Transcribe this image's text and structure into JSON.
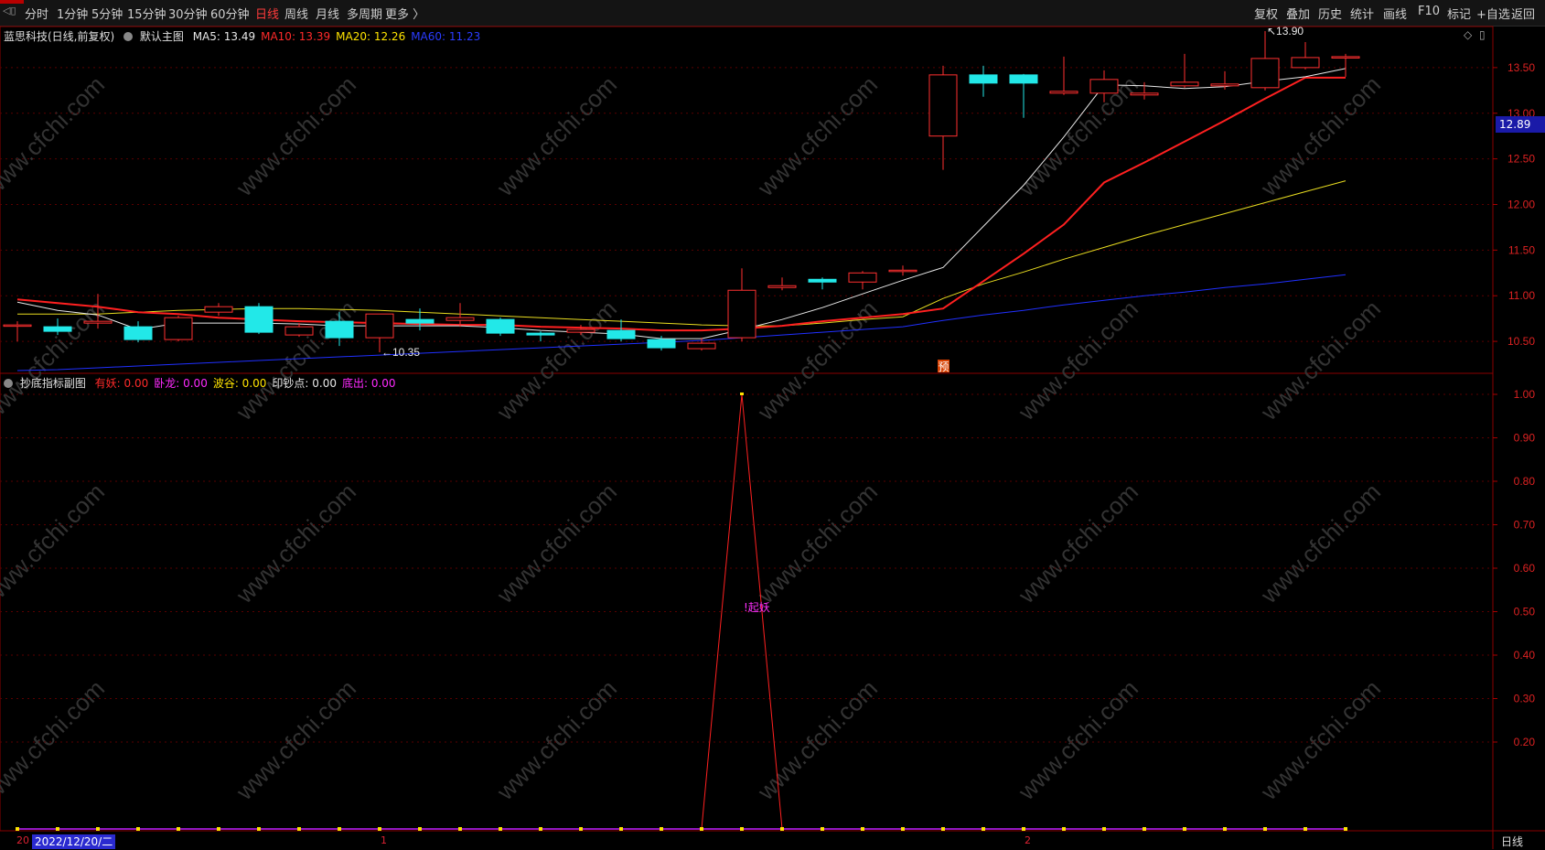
{
  "toolbar": {
    "period_tabs": [
      "分时",
      "1分钟",
      "5分钟",
      "15分钟",
      "30分钟",
      "60分钟",
      "日线",
      "周线",
      "月线",
      "多周期",
      "更多 〉"
    ],
    "active_tab": "日线",
    "right_actions": [
      "复权",
      "叠加",
      "历史",
      "统计",
      "画线",
      "F10",
      "标记",
      "+自选",
      "返回"
    ]
  },
  "main_panel": {
    "stock_title": "蓝思科技(日线,前复权)",
    "chart_name": "默认主图",
    "ma_values": [
      {
        "label": "MA5: 13.49",
        "color": "#e8e8e8"
      },
      {
        "label": "MA10: 13.39",
        "color": "#ff2a2a"
      },
      {
        "label": "MA20: 12.26",
        "color": "#ffe400"
      },
      {
        "label": "MA60: 11.23",
        "color": "#2a3cff"
      }
    ],
    "current_price": "12.89",
    "high_marker": "13.90",
    "low_marker": "10.35",
    "forecast_marker": "预",
    "y_ticks": [
      "13.50",
      "13.00",
      "12.50",
      "12.00",
      "11.50",
      "11.00",
      "10.50"
    ]
  },
  "sub_panel": {
    "indicator_name": "抄底指标副图",
    "values": [
      {
        "label": "有妖: 0.00",
        "color": "#ff2a2a"
      },
      {
        "label": "卧龙: 0.00",
        "color": "#ff2aff"
      },
      {
        "label": "波谷: 0.00",
        "color": "#ffe400"
      },
      {
        "label": "印钞点: 0.00",
        "color": "#e8e8e8"
      },
      {
        "label": "底出: 0.00",
        "color": "#ff2aff"
      }
    ],
    "signal_label": "!起妖",
    "y_ticks": [
      "1.00",
      "0.90",
      "0.80",
      "0.70",
      "0.60",
      "0.50",
      "0.40",
      "0.30",
      "0.20"
    ]
  },
  "bottom_axis": {
    "first_label": "20",
    "cursor_date": "2022/12/20/二",
    "month_marks": [
      "1",
      "2"
    ],
    "period_label": "日线"
  },
  "watermark": "www.cfchi.com",
  "chart_data": [
    {
      "type": "candlestick",
      "title": "蓝思科技(日线,前复权)",
      "ylim": [
        10.15,
        13.95
      ],
      "candles": [
        {
          "o": 10.68,
          "c": 10.68,
          "h": 10.72,
          "l": 10.5
        },
        {
          "o": 10.66,
          "c": 10.61,
          "h": 10.75,
          "l": 10.57
        },
        {
          "o": 10.7,
          "c": 10.72,
          "h": 11.02,
          "l": 10.64
        },
        {
          "o": 10.66,
          "c": 10.52,
          "h": 10.72,
          "l": 10.49
        },
        {
          "o": 10.52,
          "c": 10.76,
          "h": 10.78,
          "l": 10.5
        },
        {
          "o": 10.82,
          "c": 10.88,
          "h": 10.92,
          "l": 10.78
        },
        {
          "o": 10.88,
          "c": 10.6,
          "h": 10.92,
          "l": 10.58
        },
        {
          "o": 10.57,
          "c": 10.66,
          "h": 10.7,
          "l": 10.55
        },
        {
          "o": 10.72,
          "c": 10.54,
          "h": 10.82,
          "l": 10.45
        },
        {
          "o": 10.54,
          "c": 10.8,
          "h": 10.8,
          "l": 10.38
        },
        {
          "o": 10.74,
          "c": 10.7,
          "h": 10.86,
          "l": 10.62
        },
        {
          "o": 10.73,
          "c": 10.76,
          "h": 10.92,
          "l": 10.66
        },
        {
          "o": 10.74,
          "c": 10.59,
          "h": 10.76,
          "l": 10.56
        },
        {
          "o": 10.59,
          "c": 10.57,
          "h": 10.61,
          "l": 10.5
        },
        {
          "o": 10.6,
          "c": 10.63,
          "h": 10.68,
          "l": 10.57
        },
        {
          "o": 10.62,
          "c": 10.53,
          "h": 10.74,
          "l": 10.5
        },
        {
          "o": 10.52,
          "c": 10.43,
          "h": 10.56,
          "l": 10.4
        },
        {
          "o": 10.42,
          "c": 10.48,
          "h": 10.54,
          "l": 10.4
        },
        {
          "o": 10.54,
          "c": 11.06,
          "h": 11.3,
          "l": 10.5
        },
        {
          "o": 11.09,
          "c": 11.11,
          "h": 11.2,
          "l": 11.06
        },
        {
          "o": 11.18,
          "c": 11.15,
          "h": 11.2,
          "l": 11.07
        },
        {
          "o": 11.15,
          "c": 11.25,
          "h": 11.27,
          "l": 11.07
        },
        {
          "o": 11.27,
          "c": 11.28,
          "h": 11.33,
          "l": 11.22
        },
        {
          "o": 12.75,
          "c": 13.42,
          "h": 13.52,
          "l": 12.38
        },
        {
          "o": 13.42,
          "c": 13.33,
          "h": 13.52,
          "l": 13.18
        },
        {
          "o": 13.42,
          "c": 13.33,
          "h": 13.43,
          "l": 12.95
        },
        {
          "o": 13.22,
          "c": 13.24,
          "h": 13.62,
          "l": 13.2
        },
        {
          "o": 13.22,
          "c": 13.37,
          "h": 13.47,
          "l": 13.12
        },
        {
          "o": 13.2,
          "c": 13.22,
          "h": 13.34,
          "l": 13.15
        },
        {
          "o": 13.3,
          "c": 13.34,
          "h": 13.65,
          "l": 13.28
        },
        {
          "o": 13.3,
          "c": 13.32,
          "h": 13.46,
          "l": 13.26
        },
        {
          "o": 13.28,
          "c": 13.6,
          "h": 13.9,
          "l": 13.25
        },
        {
          "o": 13.5,
          "c": 13.61,
          "h": 13.78,
          "l": 13.48
        },
        {
          "o": 13.62,
          "c": 13.62,
          "h": 13.65,
          "l": 13.4
        }
      ],
      "series": [
        {
          "name": "MA5",
          "values": [
            10.93,
            10.84,
            10.79,
            10.63,
            10.7,
            10.7,
            10.7,
            10.69,
            10.67,
            10.67,
            10.67,
            10.67,
            10.65,
            10.62,
            10.6,
            10.58,
            10.53,
            10.53,
            10.63,
            10.74,
            10.87,
            11.02,
            11.17,
            11.31,
            11.76,
            12.21,
            12.74,
            13.31,
            13.3,
            13.27,
            13.29,
            13.35,
            13.4,
            13.49
          ]
        },
        {
          "name": "MA10",
          "values": [
            10.96,
            10.92,
            10.88,
            10.82,
            10.8,
            10.76,
            10.74,
            10.72,
            10.71,
            10.7,
            10.69,
            10.68,
            10.68,
            10.66,
            10.65,
            10.64,
            10.62,
            10.62,
            10.64,
            10.67,
            10.72,
            10.76,
            10.8,
            10.86,
            11.16,
            11.46,
            11.78,
            12.24,
            12.46,
            12.69,
            12.92,
            13.16,
            13.39,
            13.39
          ]
        },
        {
          "name": "MA20",
          "values": [
            10.8,
            10.8,
            10.8,
            10.82,
            10.84,
            10.85,
            10.86,
            10.86,
            10.85,
            10.84,
            10.82,
            10.8,
            10.78,
            10.76,
            10.74,
            10.72,
            10.7,
            10.68,
            10.67,
            10.67,
            10.7,
            10.74,
            10.77,
            10.97,
            11.13,
            11.26,
            11.4,
            11.53,
            11.66,
            11.78,
            11.9,
            12.02,
            12.14,
            12.26
          ]
        },
        {
          "name": "MA60",
          "values": [
            10.18,
            10.19,
            10.21,
            10.23,
            10.25,
            10.27,
            10.29,
            10.31,
            10.33,
            10.35,
            10.37,
            10.39,
            10.41,
            10.43,
            10.45,
            10.47,
            10.49,
            10.51,
            10.54,
            10.57,
            10.6,
            10.63,
            10.66,
            10.73,
            10.79,
            10.84,
            10.9,
            10.95,
            11.0,
            11.04,
            11.09,
            11.13,
            11.18,
            11.23
          ]
        }
      ]
    },
    {
      "type": "line",
      "title": "抄底指标副图",
      "ylim": [
        0,
        1.04
      ],
      "series": [
        {
          "name": "有妖",
          "values": [
            0,
            0,
            0,
            0,
            0,
            0,
            0,
            0,
            0,
            0,
            0,
            0,
            0,
            0,
            0,
            0,
            0,
            0,
            1.0,
            0,
            0,
            0,
            0,
            0,
            0,
            0,
            0,
            0,
            0,
            0,
            0,
            0,
            0,
            0
          ]
        },
        {
          "name": "底出",
          "values": [
            0,
            0,
            0,
            0,
            0,
            0,
            0,
            0,
            0,
            0,
            0,
            0,
            0,
            0,
            0,
            0,
            0,
            0,
            0,
            0,
            0,
            0,
            0,
            0,
            0,
            0,
            0,
            0,
            0,
            0,
            0,
            0,
            0,
            0
          ]
        }
      ]
    }
  ]
}
